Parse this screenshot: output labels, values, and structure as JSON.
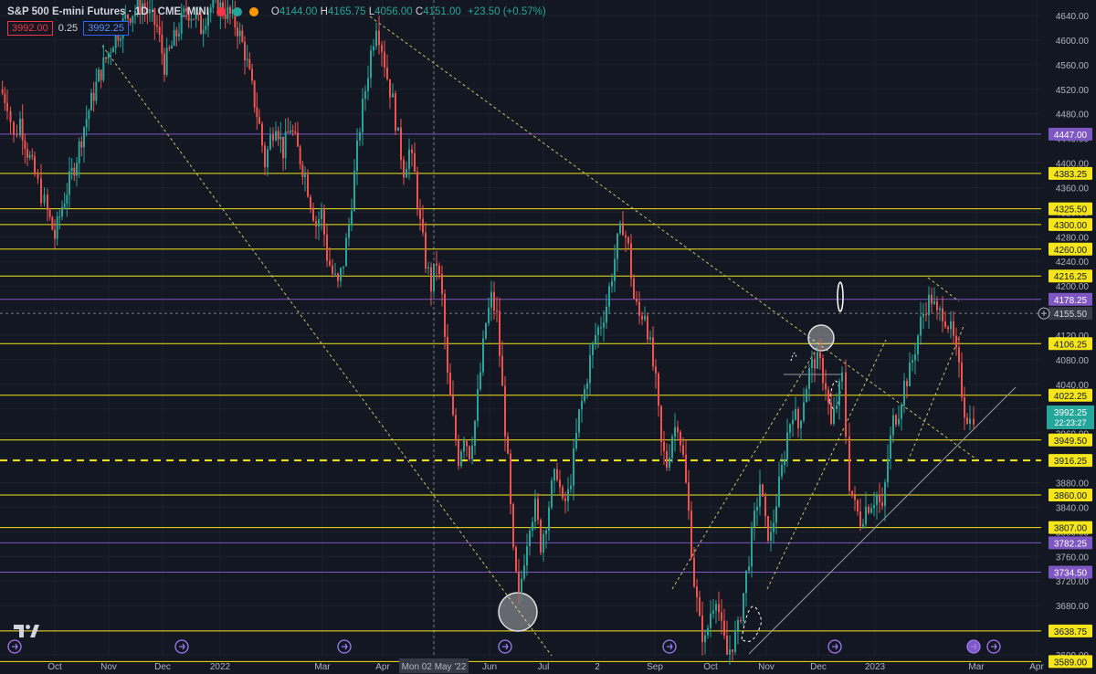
{
  "header": {
    "symbol": "S&P 500 E-mini Futures · 1D · CME_MINI",
    "open_label": "O",
    "open": "4144.00",
    "high_label": "H",
    "high": "4165.75",
    "low_label": "L",
    "low": "4056.00",
    "close_label": "C",
    "close": "4151.00",
    "change": "+23.50 (+0.57%)",
    "sell_price": "3992.00",
    "spread": "0.25",
    "buy_price": "3992.25"
  },
  "colors": {
    "background": "#131722",
    "up": "#26a69a",
    "down": "#ef5350",
    "level_yellow": "#f5e51b",
    "level_purple": "#7e57c2",
    "grid": "#1e222d"
  },
  "chart_data": {
    "type": "candlestick",
    "title": "S&P 500 E-mini Futures · 1D · CME_MINI",
    "ylim": [
      3580,
      4660
    ],
    "y_ticks": [
      "4640.00",
      "4600.00",
      "4560.00",
      "4520.00",
      "4480.00",
      "4440.00",
      "4400.00",
      "4360.00",
      "4320.00",
      "4280.00",
      "4240.00",
      "4200.00",
      "4160.00",
      "4120.00",
      "4080.00",
      "4040.00",
      "4000.00",
      "3960.00",
      "3920.00",
      "3880.00",
      "3840.00",
      "3800.00",
      "3760.00",
      "3720.00",
      "3680.00",
      "3640.00",
      "3600.00"
    ],
    "x_ticks": [
      "Oct",
      "Nov",
      "Dec",
      "2022",
      "Mar",
      "Apr",
      "Mon 02 May '22",
      "Jun",
      "Jul",
      "2",
      "Sep",
      "Oct",
      "Nov",
      "Dec",
      "2023",
      "Mar",
      "Apr"
    ],
    "price_levels": [
      {
        "label": "4447.00",
        "value": 4447.0,
        "color": "purple"
      },
      {
        "label": "4383.25",
        "value": 4383.25,
        "color": "yellow"
      },
      {
        "label": "4325.50",
        "value": 4325.5,
        "color": "yellow"
      },
      {
        "label": "4300.00",
        "value": 4300.0,
        "color": "yellow"
      },
      {
        "label": "4260.00",
        "value": 4260.0,
        "color": "yellow"
      },
      {
        "label": "4216.25",
        "value": 4216.25,
        "color": "yellow"
      },
      {
        "label": "4178.25",
        "value": 4178.25,
        "color": "purple"
      },
      {
        "label": "4106.25",
        "value": 4106.25,
        "color": "yellow"
      },
      {
        "label": "4022.25",
        "value": 4022.25,
        "color": "yellow"
      },
      {
        "label": "3949.50",
        "value": 3949.5,
        "color": "yellow"
      },
      {
        "label": "3916.25",
        "value": 3916.25,
        "color": "yellow",
        "dashed": true
      },
      {
        "label": "3860.00",
        "value": 3860.0,
        "color": "yellow"
      },
      {
        "label": "3807.00",
        "value": 3807.0,
        "color": "yellow"
      },
      {
        "label": "3782.25",
        "value": 3782.25,
        "color": "purple"
      },
      {
        "label": "3734.50",
        "value": 3734.5,
        "color": "purple"
      },
      {
        "label": "3638.75",
        "value": 3638.75,
        "color": "yellow"
      },
      {
        "label": "3589.00",
        "value": 3589.0,
        "color": "yellow"
      }
    ],
    "crosshair_price": "4155.50",
    "last_price": "3992.25",
    "countdown": "22:23:27",
    "price_path": [
      [
        0,
        4520
      ],
      [
        8,
        4500
      ],
      [
        15,
        4440
      ],
      [
        22,
        4470
      ],
      [
        30,
        4420
      ],
      [
        38,
        4380
      ],
      [
        45,
        4350
      ],
      [
        52,
        4320
      ],
      [
        60,
        4280
      ],
      [
        68,
        4330
      ],
      [
        76,
        4370
      ],
      [
        84,
        4410
      ],
      [
        92,
        4460
      ],
      [
        100,
        4500
      ],
      [
        108,
        4540
      ],
      [
        116,
        4570
      ],
      [
        124,
        4600
      ],
      [
        132,
        4620
      ],
      [
        140,
        4640
      ],
      [
        148,
        4650
      ],
      [
        156,
        4660
      ],
      [
        164,
        4640
      ],
      [
        172,
        4620
      ],
      [
        180,
        4560
      ],
      [
        188,
        4590
      ],
      [
        196,
        4620
      ],
      [
        204,
        4650
      ],
      [
        212,
        4640
      ],
      [
        220,
        4620
      ],
      [
        228,
        4650
      ],
      [
        236,
        4660
      ],
      [
        244,
        4650
      ],
      [
        252,
        4640
      ],
      [
        260,
        4620
      ],
      [
        268,
        4580
      ],
      [
        276,
        4520
      ],
      [
        284,
        4460
      ],
      [
        290,
        4400
      ],
      [
        296,
        4440
      ],
      [
        302,
        4470
      ],
      [
        310,
        4420
      ],
      [
        318,
        4460
      ],
      [
        326,
        4420
      ],
      [
        334,
        4380
      ],
      [
        340,
        4340
      ],
      [
        346,
        4300
      ],
      [
        352,
        4320
      ],
      [
        358,
        4250
      ],
      [
        364,
        4220
      ],
      [
        370,
        4200
      ],
      [
        376,
        4240
      ],
      [
        382,
        4300
      ],
      [
        388,
        4380
      ],
      [
        394,
        4460
      ],
      [
        400,
        4520
      ],
      [
        406,
        4580
      ],
      [
        412,
        4630
      ],
      [
        418,
        4590
      ],
      [
        424,
        4540
      ],
      [
        430,
        4500
      ],
      [
        436,
        4440
      ],
      [
        442,
        4390
      ],
      [
        448,
        4420
      ],
      [
        454,
        4380
      ],
      [
        460,
        4300
      ],
      [
        466,
        4240
      ],
      [
        472,
        4200
      ],
      [
        478,
        4240
      ],
      [
        484,
        4180
      ],
      [
        490,
        4050
      ],
      [
        496,
        3980
      ],
      [
        502,
        3920
      ],
      [
        508,
        3960
      ],
      [
        514,
        3930
      ],
      [
        520,
        3980
      ],
      [
        526,
        4060
      ],
      [
        532,
        4140
      ],
      [
        538,
        4180
      ],
      [
        544,
        4150
      ],
      [
        550,
        4030
      ],
      [
        556,
        3910
      ],
      [
        562,
        3760
      ],
      [
        568,
        3690
      ],
      [
        574,
        3760
      ],
      [
        580,
        3820
      ],
      [
        586,
        3840
      ],
      [
        592,
        3780
      ],
      [
        598,
        3820
      ],
      [
        604,
        3870
      ],
      [
        610,
        3900
      ],
      [
        616,
        3840
      ],
      [
        622,
        3860
      ],
      [
        628,
        3920
      ],
      [
        634,
        3990
      ],
      [
        640,
        4030
      ],
      [
        646,
        4080
      ],
      [
        652,
        4120
      ],
      [
        658,
        4140
      ],
      [
        664,
        4170
      ],
      [
        670,
        4220
      ],
      [
        676,
        4270
      ],
      [
        682,
        4300
      ],
      [
        688,
        4260
      ],
      [
        694,
        4180
      ],
      [
        700,
        4150
      ],
      [
        706,
        4160
      ],
      [
        712,
        4100
      ],
      [
        718,
        4040
      ],
      [
        724,
        3940
      ],
      [
        730,
        3910
      ],
      [
        736,
        3960
      ],
      [
        742,
        3980
      ],
      [
        748,
        3920
      ],
      [
        754,
        3830
      ],
      [
        760,
        3720
      ],
      [
        766,
        3650
      ],
      [
        772,
        3620
      ],
      [
        778,
        3670
      ],
      [
        784,
        3700
      ],
      [
        790,
        3640
      ],
      [
        796,
        3600
      ],
      [
        802,
        3620
      ],
      [
        808,
        3640
      ],
      [
        814,
        3700
      ],
      [
        820,
        3760
      ],
      [
        826,
        3820
      ],
      [
        832,
        3880
      ],
      [
        838,
        3810
      ],
      [
        844,
        3790
      ],
      [
        850,
        3850
      ],
      [
        856,
        3900
      ],
      [
        862,
        3960
      ],
      [
        868,
        4000
      ],
      [
        874,
        3970
      ],
      [
        880,
        4020
      ],
      [
        886,
        4060
      ],
      [
        892,
        4080
      ],
      [
        898,
        4070
      ],
      [
        904,
        4040
      ],
      [
        910,
        3970
      ],
      [
        916,
        4010
      ],
      [
        922,
        4050
      ],
      [
        926,
        3960
      ],
      [
        930,
        3880
      ],
      [
        936,
        3840
      ],
      [
        942,
        3820
      ],
      [
        948,
        3840
      ],
      [
        954,
        3850
      ],
      [
        960,
        3860
      ],
      [
        966,
        3830
      ],
      [
        972,
        3920
      ],
      [
        978,
        3980
      ],
      [
        984,
        4000
      ],
      [
        990,
        4040
      ],
      [
        996,
        4060
      ],
      [
        1002,
        4100
      ],
      [
        1008,
        4140
      ],
      [
        1014,
        4170
      ],
      [
        1020,
        4180
      ],
      [
        1026,
        4150
      ],
      [
        1032,
        4160
      ],
      [
        1038,
        4140
      ],
      [
        1044,
        4110
      ],
      [
        1050,
        4060
      ],
      [
        1056,
        4000
      ],
      [
        1062,
        3980
      ],
      [
        1066,
        3992
      ]
    ],
    "grid": true
  },
  "tv_logo": "tradingview-logo"
}
